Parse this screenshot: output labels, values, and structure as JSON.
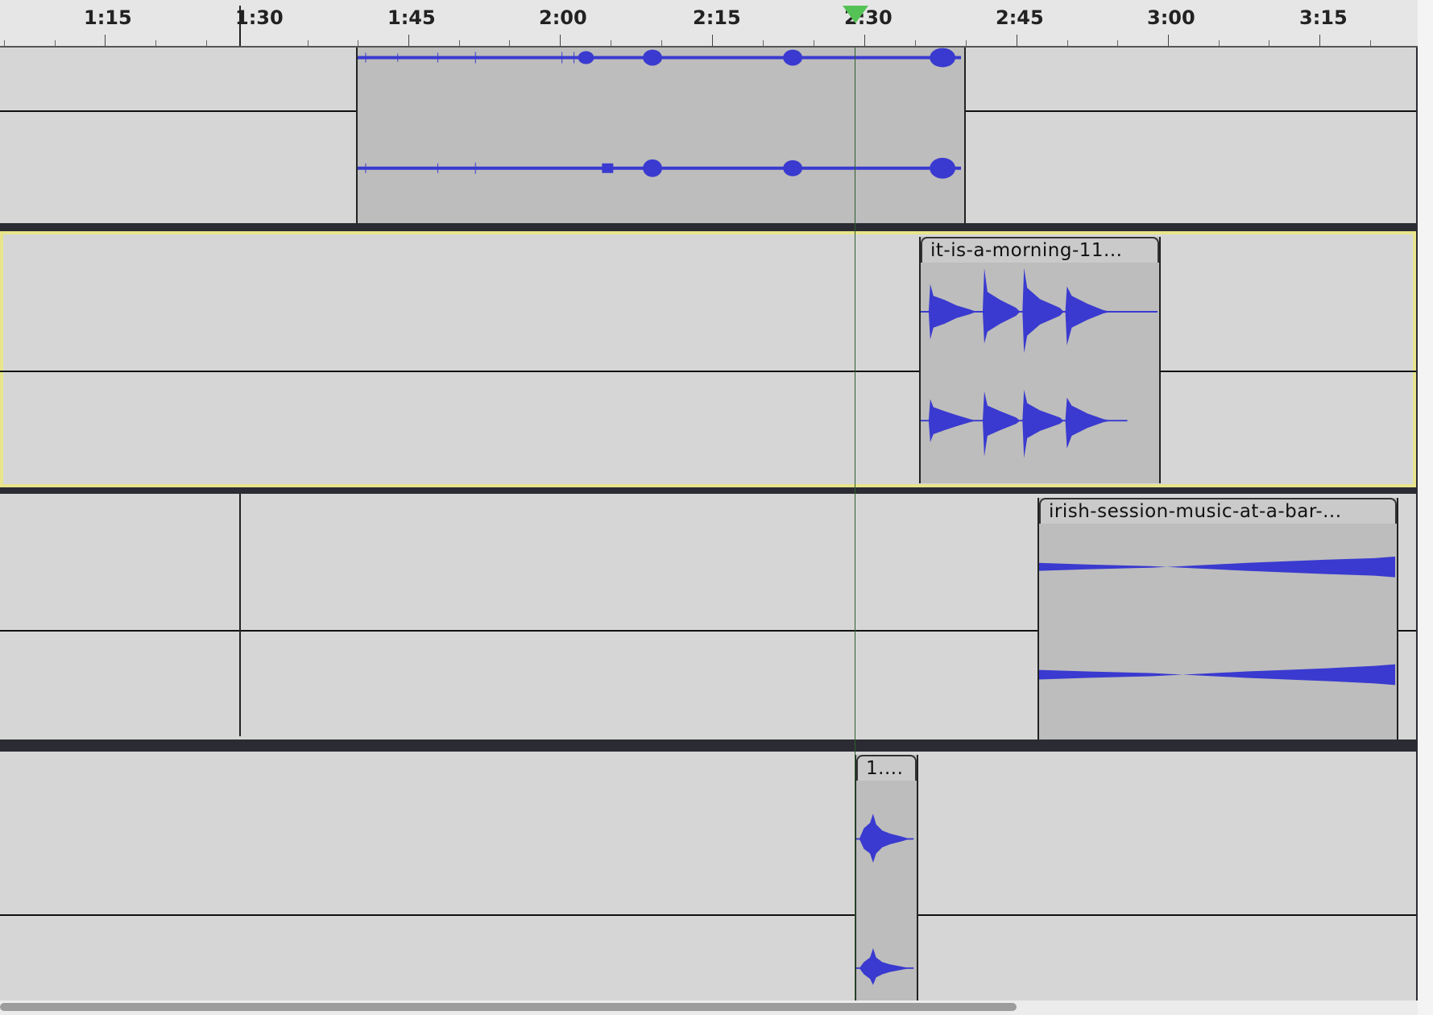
{
  "timeline": {
    "ticks": [
      "1:15",
      "1:30",
      "1:45",
      "2:00",
      "2:15",
      "2:30",
      "2:45",
      "3:00",
      "3:15"
    ]
  },
  "tracks": [
    {
      "name": "track-1",
      "clips": [
        {
          "label": ""
        }
      ]
    },
    {
      "name": "track-2",
      "selected": true,
      "clips": [
        {
          "label": "it-is-a-morning-11..."
        }
      ]
    },
    {
      "name": "track-3",
      "clips": [
        {
          "label": "irish-session-music-at-a-bar-..."
        }
      ]
    },
    {
      "name": "track-4",
      "clips": [
        {
          "label": "1...."
        }
      ]
    }
  ],
  "colors": {
    "waveform": "#3a3ad0",
    "selected_track_border": "#e8e48c",
    "playhead": "#55c255"
  }
}
